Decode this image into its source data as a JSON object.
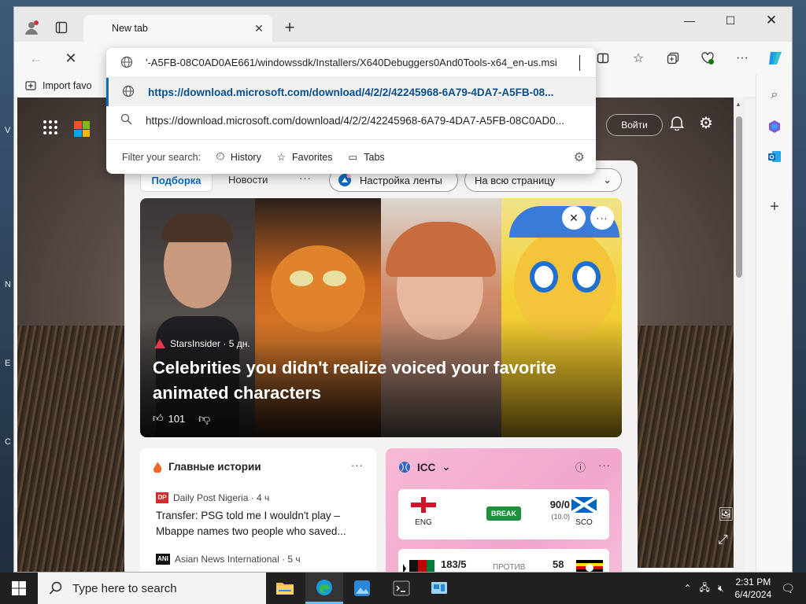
{
  "desktop": {
    "edge_letters": [
      "V",
      "N",
      "E",
      "C"
    ]
  },
  "browser": {
    "tab": {
      "title": "New tab"
    },
    "toolbar": {
      "import_favorites_label": "Import favo"
    },
    "omnibox": {
      "input_text": "'-A5FB-08C0AD0AE661/windowssdk/Installers/X640Debuggers0And0Tools-x64_en-us.msi",
      "suggestions": [
        {
          "text": "https://download.microsoft.com/download/4/2/2/42245968-6A79-4DA7-A5FB-08...",
          "icon": "globe-icon"
        },
        {
          "text": "https://download.microsoft.com/download/4/2/2/42245968-6A79-4DA7-A5FB-08C0AD0...",
          "icon": "search-icon"
        }
      ],
      "filter_label": "Filter your search:",
      "filters": [
        "History",
        "Favorites",
        "Tabs"
      ]
    }
  },
  "page": {
    "signin_label": "Войти",
    "feed": {
      "tabs": [
        "Подборка",
        "Новости"
      ],
      "personalize_label": "Настройка ленты",
      "layout_label": "На всю страницу",
      "hero": {
        "source": "StarsInsider · 5 дн.",
        "title": "Celebrities you didn't realize voiced your favorite animated characters",
        "likes": "101"
      },
      "top_stories": {
        "header": "Главные истории",
        "items": [
          {
            "source": "Daily Post Nigeria · 4 ч",
            "badge": "DP",
            "title": "Transfer: PSG told me I wouldn't play – Mbappe names two people who saved..."
          },
          {
            "source": "Asian News International · 5 ч",
            "badge": "ANI",
            "title": ""
          }
        ]
      },
      "icc": {
        "header": "ICC",
        "match1": {
          "team_a": "ENG",
          "team_b": "SCO",
          "status": "BREAK",
          "score": "90/0",
          "overs": "(10.0)"
        },
        "match2": {
          "score_a": "183/5",
          "vs": "ПРОТИВ",
          "score_b": "58"
        }
      }
    }
  },
  "taskbar": {
    "search_placeholder": "Type here to search",
    "time": "2:31 PM",
    "date": "6/4/2024"
  },
  "colors": {
    "accent": "#0f6cbd",
    "taskbar": "#202020",
    "break_badge": "#1e8f3d"
  }
}
